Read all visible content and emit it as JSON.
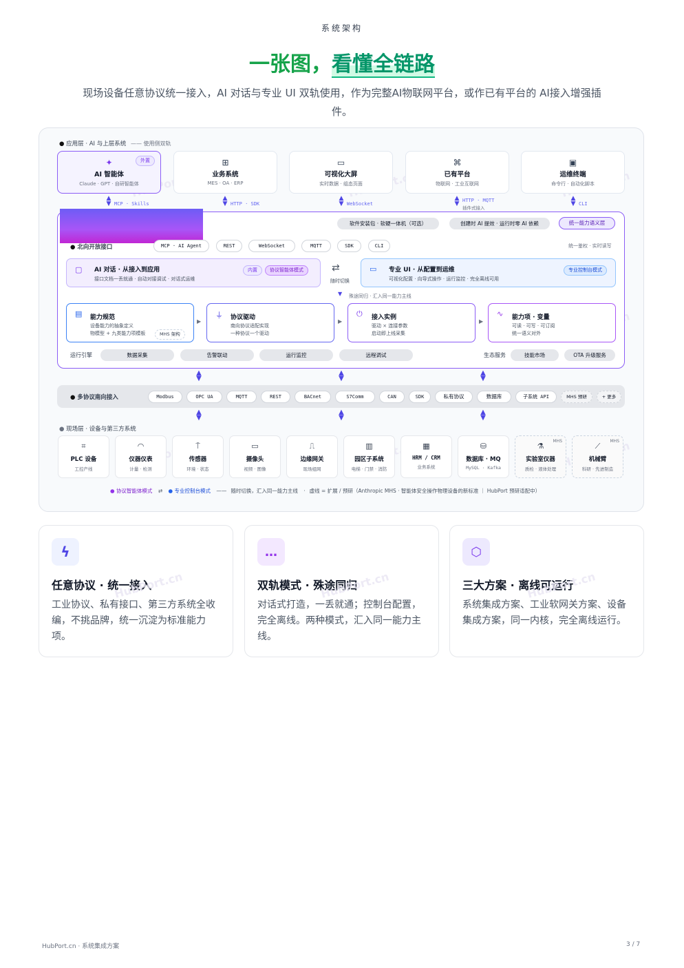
{
  "header": {
    "eyebrow": "系统架构",
    "title_a": "一张图，",
    "title_b": "看懂全链路",
    "subtitle": "现场设备任意协议统一接入，AI 对话与专业 UI 双轨使用，作为完整AI物联网平台，或作已有平台的 AI接入增强插件。"
  },
  "app_layer": {
    "label": "应用层 · AI 与上层系统",
    "note": "—— 使用侧双轨",
    "cards": [
      {
        "icon": "sparkles-icon",
        "glyph": "✦",
        "name": "AI 智能体",
        "sub": "Claude · GPT · 自研智能体",
        "badge": "外置"
      },
      {
        "icon": "grid-icon",
        "glyph": "⊞",
        "name": "业务系统",
        "sub": "MES · OA · ERP"
      },
      {
        "icon": "monitor-icon",
        "glyph": "▭",
        "name": "可视化大屏",
        "sub": "实时数据 · 组态页面"
      },
      {
        "icon": "network-icon",
        "glyph": "⌘",
        "name": "已有平台",
        "sub": "物联网 · 工业互联网"
      },
      {
        "icon": "terminal-icon",
        "glyph": "▣",
        "name": "运维终端",
        "sub": "命令行 · 自动化脚本"
      }
    ],
    "connectors": [
      "MCP · Skills",
      "HTTP · SDK",
      "WebSocket",
      "HTTP · MQTT",
      "CLI"
    ],
    "connector_note": "插件式接入"
  },
  "core": {
    "top_pills": [
      "软件安装包 · 软硬一体机（可选）",
      "创建时 AI 提效 · 运行时零 AI 依赖"
    ],
    "top_tag": "统一能力语义层",
    "north_label": "北向开放接口",
    "north_pills": [
      "MCP · AI Agent",
      "REST",
      "WebSocket",
      "MQTT",
      "SDK",
      "CLI"
    ],
    "north_note": "统一鉴权 · 实时读写",
    "ai_track": {
      "title": "AI 对话 · 从接入到应用",
      "desc": "接口文档一丢就通 · 自动对接调试 · 对话式运维",
      "badge1": "内置",
      "badge2": "协议智能体模式"
    },
    "switch_label": "随时切换",
    "switch_glyph": "⇄",
    "ui_track": {
      "title": "专业 UI · 从配置到运维",
      "desc": "可视化配置 · 向导式操作 · 运行监控 · 完全离线可用",
      "badge": "专业控制台模式"
    },
    "merge_note": "殊途同归 · 汇入同一能力主线",
    "caps": [
      {
        "icon": "doc-icon",
        "glyph": "▤",
        "name": "能力规范",
        "l1": "设备能力的抽象定义",
        "l2": "物模型 + 九类能力项模板",
        "badge": "MHS 架构"
      },
      {
        "icon": "plug-icon",
        "glyph": "⏚",
        "name": "协议驱动",
        "l1": "南向协议适配实现",
        "l2": "一种协议一个驱动"
      },
      {
        "icon": "power-icon",
        "glyph": "⏻",
        "name": "接入实例",
        "l1": "驱动 × 连接参数",
        "l2": "启动即上线采集"
      },
      {
        "icon": "pulse-icon",
        "glyph": "∿",
        "name": "能力项 · 变量",
        "l1": "可读 · 可写 · 可订阅",
        "l2": "统一语义对外"
      }
    ],
    "engine_label": "运行引擎",
    "engine_items": [
      "数据采集",
      "告警联动",
      "运行监控",
      "远程调试"
    ],
    "eco_label": "生态服务",
    "eco_items": [
      "技能市场",
      "OTA 升级服务"
    ]
  },
  "south": {
    "label": "多协议南向接入",
    "pills": [
      "Modbus",
      "OPC UA",
      "MQTT",
      "REST",
      "BACnet",
      "S7Comm",
      "CAN",
      "SDK",
      "私有协议",
      "数据库",
      "子系统 API"
    ],
    "extra1": "MHS 预研",
    "extra2": "+ 更多"
  },
  "field_layer": {
    "label": "现场层 · 设备与第三方系统",
    "items": [
      {
        "icon": "chip-icon",
        "glyph": "⌗",
        "name": "PLC 设备",
        "sub": "工控产线"
      },
      {
        "icon": "gauge-icon",
        "glyph": "◠",
        "name": "仪器仪表",
        "sub": "计量 · 检测"
      },
      {
        "icon": "antenna-icon",
        "glyph": "⍑",
        "name": "传感器",
        "sub": "环境 · 状态"
      },
      {
        "icon": "camera-icon",
        "glyph": "▭",
        "name": "摄像头",
        "sub": "视频 · 图像"
      },
      {
        "icon": "router-icon",
        "glyph": "⎍",
        "name": "边缘网关",
        "sub": "现场组网"
      },
      {
        "icon": "building-icon",
        "glyph": "▥",
        "name": "园区子系统",
        "sub": "电梯 · 门禁 · 消防"
      },
      {
        "icon": "office-icon",
        "glyph": "▦",
        "name": "HRM / CRM",
        "sub": "业务系统"
      },
      {
        "icon": "database-icon",
        "glyph": "⛁",
        "name": "数据库 · MQ",
        "sub": "MySQL · Kafka"
      },
      {
        "icon": "flask-icon",
        "glyph": "⚗",
        "name": "实验室仪器",
        "sub": "质检 · 液体处理",
        "tag": "MHS"
      },
      {
        "icon": "robot-arm-icon",
        "glyph": "⟋",
        "name": "机械臂",
        "sub": "科研 · 先进制造",
        "tag": "MHS"
      }
    ]
  },
  "legend": {
    "a": "协议智能体模式",
    "swap": "⇄",
    "b": "专业控制台模式",
    "c": "随时切换，汇入同一能力主线",
    "d": "虚线 = 扩展 / 预研（Anthropic MHS · 智能体安全操作物理设备的新标准 ｜ HubPort 预研适配中）"
  },
  "features": [
    {
      "icon": "bolt-icon",
      "glyph": "ϟ",
      "title": "任意协议 · 统一接入",
      "desc": "工业协议、私有接口、第三方系统全收编，不挑品牌，统一沉淀为标准能力项。",
      "bg": "#eef2ff",
      "fg": "#4f46e5"
    },
    {
      "icon": "chat-icon",
      "glyph": "…",
      "title": "双轨模式 · 殊途同归",
      "desc": "对话式打造，一丢就通；控制台配置，完全离线。两种模式，汇入同一能力主线。",
      "bg": "#f3e8ff",
      "fg": "#9333ea"
    },
    {
      "icon": "cube-icon",
      "glyph": "⬡",
      "title": "三大方案 · 离线可运行",
      "desc": "系统集成方案、工业软网关方案、设备集成方案，同一内核，完全离线运行。",
      "bg": "#ede9fe",
      "fg": "#7c3aed"
    }
  ],
  "watermark": "HubPort.cn",
  "footer": {
    "left": "HubPort.cn · 系统集成方案",
    "right": "3 / 7"
  }
}
